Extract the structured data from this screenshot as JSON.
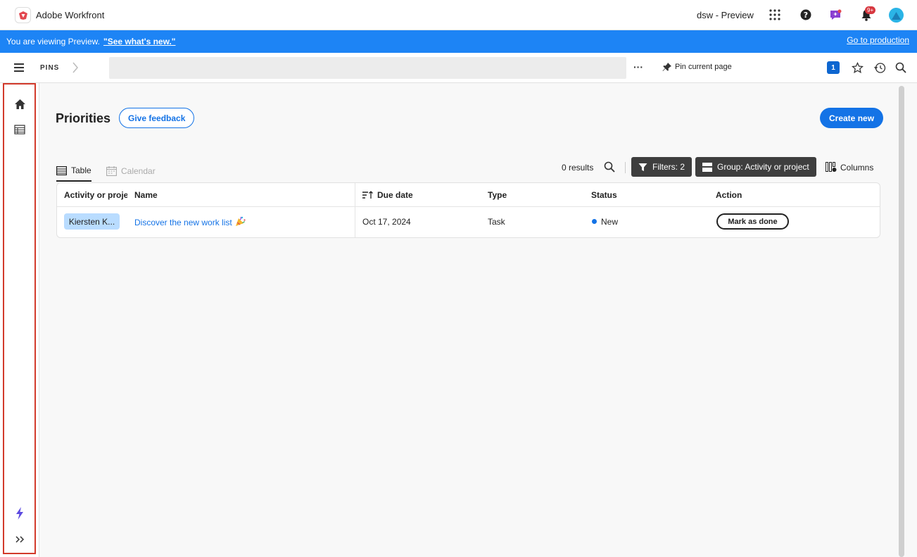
{
  "topbar": {
    "app_title": "Adobe Workfront",
    "environment": "dsw - Preview",
    "notification_count": "9+",
    "icons": [
      "app-logo-icon",
      "apps-grid-icon",
      "help-icon",
      "announcements-icon",
      "bell-icon",
      "user-avatar"
    ]
  },
  "banner": {
    "text": "You are viewing Preview.",
    "link": "\"See what's new.\"",
    "go_to_production": "Go to production"
  },
  "navbar": {
    "pins_label": "PINS",
    "more_label": "···",
    "pin_current": "Pin current page",
    "badge_count": "1"
  },
  "page": {
    "title": "Priorities",
    "give_feedback": "Give feedback",
    "create_new": "Create new"
  },
  "toolbar": {
    "tab_table": "Table",
    "tab_calendar": "Calendar",
    "results": "0 results",
    "filters": "Filters: 2",
    "group": "Group: Activity or project",
    "columns": "Columns"
  },
  "table": {
    "headers": {
      "activity": "Activity or projec",
      "name": "Name",
      "due_date": "Due date",
      "type": "Type",
      "status": "Status",
      "action": "Action"
    },
    "rows": [
      {
        "activity": "Kiersten K...",
        "name": "Discover the new work list",
        "due_date": "Oct 17, 2024",
        "type": "Task",
        "status": "New",
        "action": "Mark as done"
      }
    ]
  },
  "colors": {
    "accent": "#1473e6",
    "banner": "#1d84f5",
    "rail_outline": "#d23a2b",
    "dark_button": "#3e3e3e",
    "pill": "#b9dcff"
  }
}
